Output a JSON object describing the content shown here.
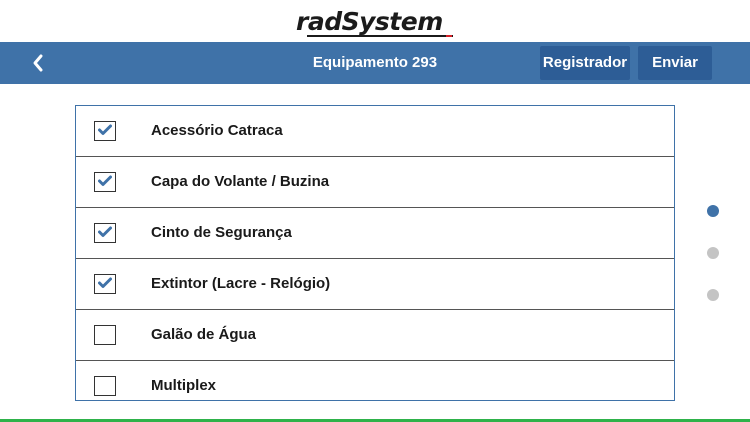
{
  "logo": {
    "part1": "rad",
    "part2": "System"
  },
  "header": {
    "title": "Equipamento 293",
    "register_label": "Registrador",
    "send_label": "Enviar"
  },
  "colors": {
    "header": "#3f72a8",
    "button": "#2d5d96",
    "check": "#3f72a8",
    "dot_active": "#3f72a8",
    "dot_inactive": "#c4c4c4",
    "bottom_line": "#2eb24a"
  },
  "items": [
    {
      "label": "Acessório Catraca",
      "checked": true
    },
    {
      "label": "Capa do Volante / Buzina",
      "checked": true
    },
    {
      "label": "Cinto de Segurança",
      "checked": true
    },
    {
      "label": "Extintor (Lacre - Relógio)",
      "checked": true
    },
    {
      "label": "Galão de Água",
      "checked": false
    },
    {
      "label": "Multiplex",
      "checked": false
    }
  ],
  "pager": {
    "pages": 3,
    "current": 1
  },
  "icons": {
    "back": "chevron-left-icon",
    "check": "check-icon"
  }
}
